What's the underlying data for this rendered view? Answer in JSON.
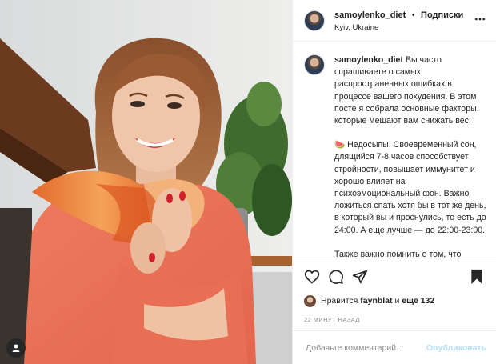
{
  "header": {
    "username": "samoylenko_diet",
    "separator": "•",
    "follow_label": "Подписки",
    "location": "Kyiv, Ukraine"
  },
  "caption": {
    "username": "samoylenko_diet",
    "intro": "Вы часто спрашиваете о самых распространенных ошибках в процессе вашего похудения. В этом посте я собрала основные факторы, которые мешают вам снижать вес:",
    "emoji": "🍉",
    "point1": "Недосыпы. Своевременный сон, длящийся 7-8 часов способствует стройности, повышает иммунитет и хорошо влияет на психоэмоциональный фон. Важно ложиться спать хотя бы в тот же день, в который вы и проснулись, то есть до 24:00. А еще лучше — до 22:00-23:00.",
    "point2": "Также важно помнить о том, что гормон, отвечающий за липолиз"
  },
  "likes": {
    "prefix": "Нравится",
    "user": "faynblat",
    "and": "и",
    "count": "ещё 132"
  },
  "timestamp": "22 МИНУТ НАЗАД",
  "comment": {
    "placeholder": "Добавьте комментарий...",
    "publish_label": "Опубликовать"
  },
  "colors": {
    "accent_disabled": "#b2dffc",
    "text": "#262626",
    "muted": "#8e8e8e"
  },
  "icons": [
    "more-options-icon",
    "heart-icon",
    "comment-icon",
    "share-icon",
    "bookmark-icon",
    "user-tag-icon"
  ]
}
